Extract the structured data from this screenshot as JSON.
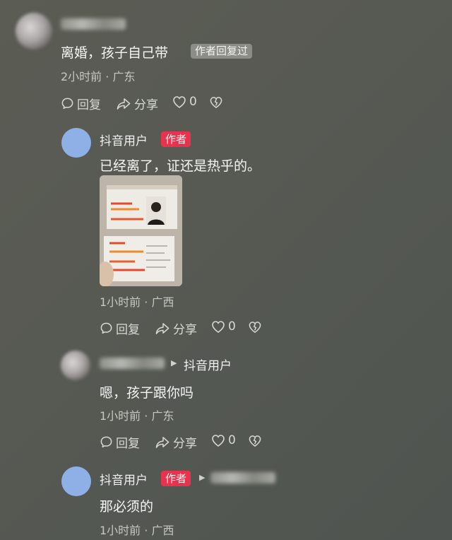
{
  "comment1": {
    "text": "离婚，孩子自己带",
    "replied_tag": "作者回复过",
    "meta": "2小时前 · 广东",
    "reply_label": "回复",
    "share_label": "分享",
    "likes": "0"
  },
  "reply1": {
    "username": "抖音用户",
    "author_tag": "作者",
    "text": "已经离了，证还是热乎的。",
    "meta": "1小时前 · 广西",
    "reply_label": "回复",
    "share_label": "分享",
    "likes": "0"
  },
  "reply2": {
    "target_user": "抖音用户",
    "text": "嗯，孩子跟你吗",
    "meta": "1小时前 · 广东",
    "reply_label": "回复",
    "share_label": "分享",
    "likes": "0"
  },
  "reply3": {
    "username": "抖音用户",
    "author_tag": "作者",
    "text": "那必须的",
    "meta": "1小时前 · 广西"
  },
  "icons": [
    "comment-bubble-icon",
    "share-arrow-icon",
    "heart-icon",
    "broken-heart-icon"
  ],
  "colors": {
    "author_tag": "#e8334f",
    "avatar": "#8fb0e6"
  }
}
